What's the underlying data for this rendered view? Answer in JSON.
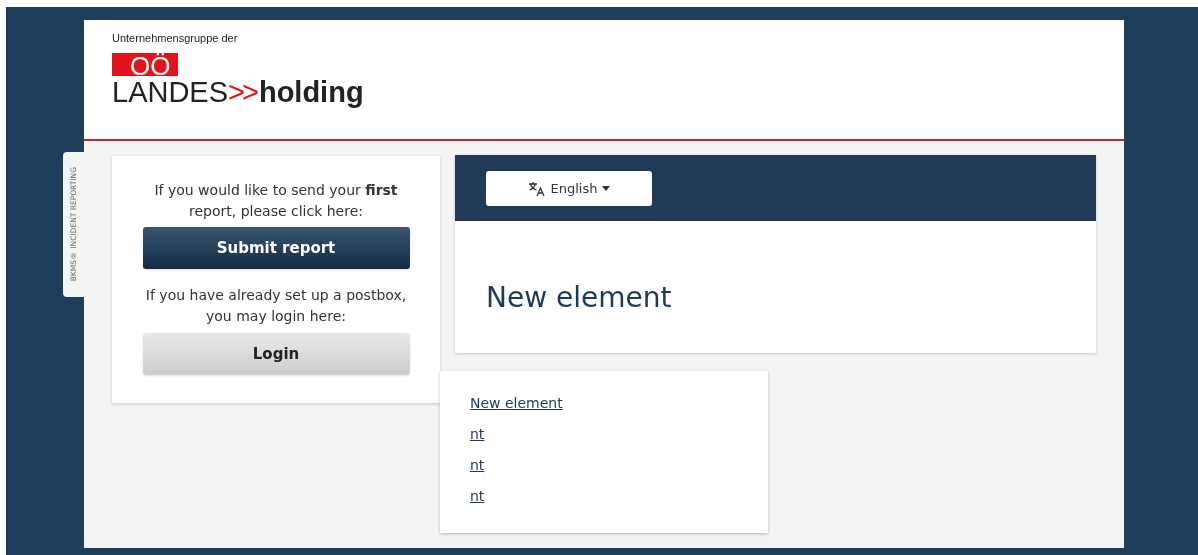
{
  "brand": {
    "tagline": "Unternehmensgruppe der",
    "logo_badge": "OÖ",
    "logo_word": "LANDES",
    "logo_arrows": ">>",
    "logo_suffix": "holding"
  },
  "side_tab": "BKMS® INCIDENT REPORTING",
  "login_card": {
    "intro": "If you would like to send your **first** report, please click here:",
    "submit_button": "Submit report",
    "login_intro": "If you have already set up a postbox, you may login here:",
    "login_button": "Login"
  },
  "language_button": {
    "label": "English"
  },
  "content": {
    "heading": "New element"
  },
  "menu": {
    "items": [
      {
        "label": "New element"
      },
      {
        "label": "nt"
      },
      {
        "label": "nt"
      },
      {
        "label": "nt"
      }
    ]
  }
}
